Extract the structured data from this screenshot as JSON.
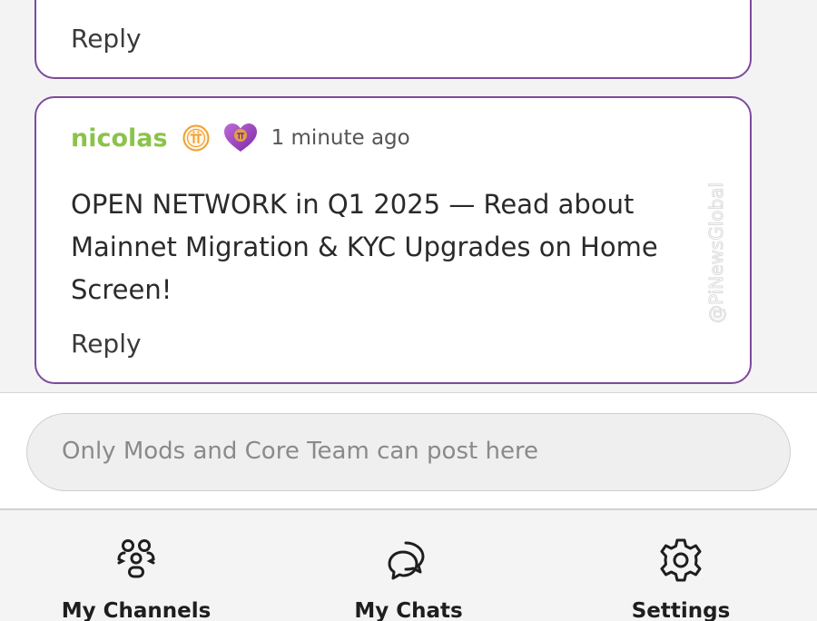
{
  "previous_comment": {
    "reply_label": "Reply"
  },
  "comment": {
    "username": "nicolas",
    "timestamp": "1 minute ago",
    "message": "OPEN NETWORK in Q1 2025 — Read about Mainnet Migration & KYC Upgrades on Home Screen!",
    "reply_label": "Reply",
    "badges": [
      "pi-coin-icon",
      "pi-heart-icon"
    ]
  },
  "watermark": {
    "text": "@PiNewsGlobal"
  },
  "composer": {
    "placeholder": "Only Mods and Core Team can post here"
  },
  "bottom_nav": {
    "items": [
      {
        "label": "My Channels",
        "icon": "channels-icon"
      },
      {
        "label": "My Chats",
        "icon": "chats-icon"
      },
      {
        "label": "Settings",
        "icon": "gear-icon"
      }
    ]
  },
  "colors": {
    "card_border": "#7d4a9c",
    "username": "#8bc34a",
    "pi_badge": "#f0a030",
    "heart_badge": "#9b3fc4"
  }
}
